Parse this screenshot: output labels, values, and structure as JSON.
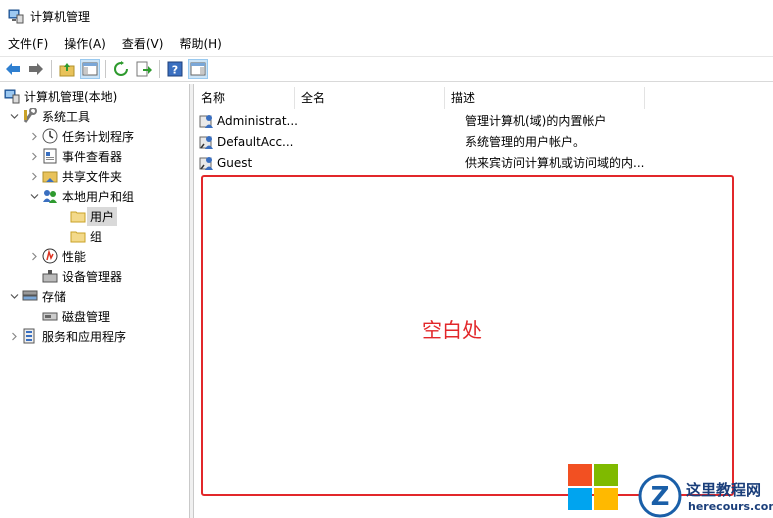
{
  "window": {
    "title": "计算机管理"
  },
  "menu": [
    "文件(F)",
    "操作(A)",
    "查看(V)",
    "帮助(H)"
  ],
  "tree": [
    {
      "label": "计算机管理(本地)",
      "icon": "computer-management-icon",
      "level": 0,
      "arrow": ""
    },
    {
      "label": "系统工具",
      "icon": "system-tools-icon",
      "level": 1,
      "arrow": "expanded"
    },
    {
      "label": "任务计划程序",
      "icon": "task-scheduler-icon",
      "level": 2,
      "arrow": "collapsed"
    },
    {
      "label": "事件查看器",
      "icon": "event-viewer-icon",
      "level": 2,
      "arrow": "collapsed"
    },
    {
      "label": "共享文件夹",
      "icon": "shared-folders-icon",
      "level": 2,
      "arrow": "collapsed"
    },
    {
      "label": "本地用户和组",
      "icon": "local-users-groups-icon",
      "level": 2,
      "arrow": "expanded"
    },
    {
      "label": "用户",
      "icon": "folder-icon",
      "level": 3,
      "arrow": "",
      "selected": true
    },
    {
      "label": "组",
      "icon": "folder-icon",
      "level": 3,
      "arrow": ""
    },
    {
      "label": "性能",
      "icon": "performance-icon",
      "level": 2,
      "arrow": "collapsed"
    },
    {
      "label": "设备管理器",
      "icon": "device-manager-icon",
      "level": 2,
      "arrow": ""
    },
    {
      "label": "存储",
      "icon": "storage-icon",
      "level": 1,
      "arrow": "expanded"
    },
    {
      "label": "磁盘管理",
      "icon": "disk-management-icon",
      "level": 2,
      "arrow": ""
    },
    {
      "label": "服务和应用程序",
      "icon": "services-applications-icon",
      "level": 1,
      "arrow": "collapsed"
    }
  ],
  "list": {
    "columns": [
      "名称",
      "全名",
      "描述"
    ],
    "rows": [
      {
        "name": "Administrat...",
        "fullname": "",
        "description": "管理计算机(域)的内置帐户"
      },
      {
        "name": "DefaultAcc...",
        "fullname": "",
        "description": "系统管理的用户帐户。"
      },
      {
        "name": "Guest",
        "fullname": "",
        "description": "供来宾访问计算机或访问域的内..."
      }
    ]
  },
  "annotation": {
    "text": "空白处",
    "color": "#e2272a"
  },
  "watermark": {
    "brand": "这里教程网",
    "url": "herecours.com"
  },
  "colors": {
    "selection": "#d9d9d9",
    "toolbar_pressed": "#cce4f7",
    "accent_blue": "#1a73c8"
  }
}
